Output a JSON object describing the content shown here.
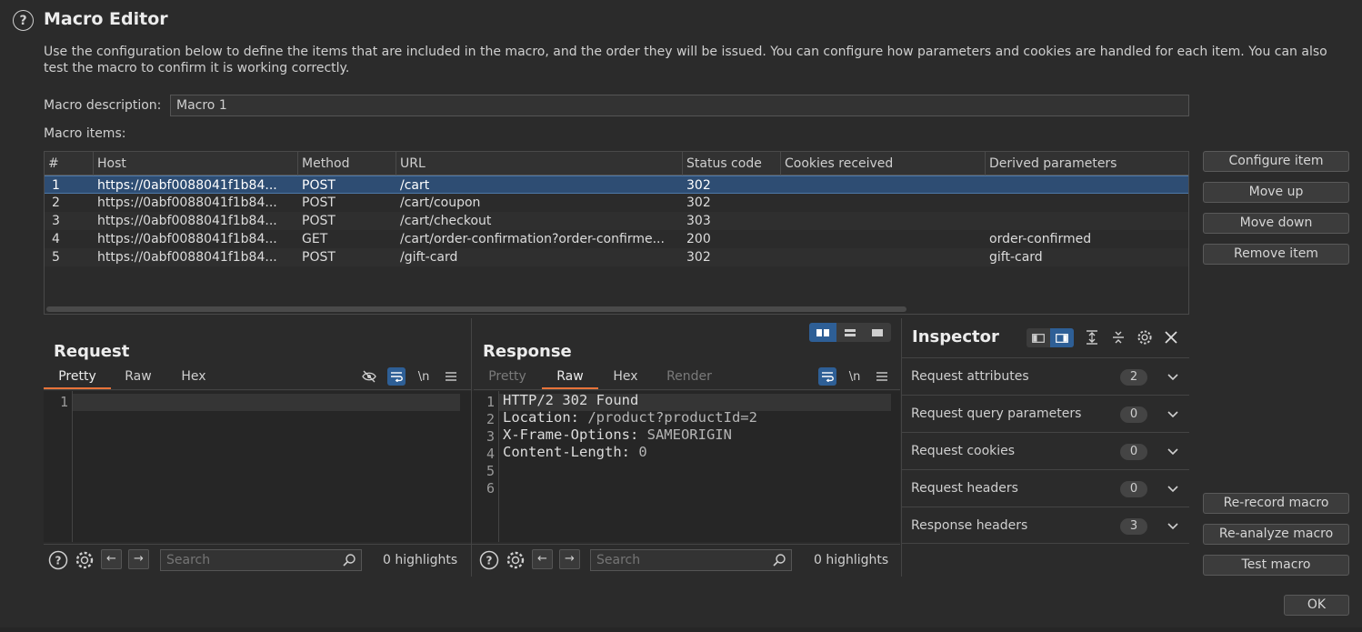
{
  "window": {
    "title": "Macro Editor",
    "description": "Use the configuration below to define the items that are included in the macro, and the order they will be issued. You can configure how parameters and cookies are handled for each item. You can also test the macro to confirm it is working correctly."
  },
  "macro": {
    "description_label": "Macro description:",
    "description_value": "Macro 1",
    "items_label": "Macro items:"
  },
  "table": {
    "columns": [
      "#",
      "Host",
      "Method",
      "URL",
      "Status code",
      "Cookies received",
      "Derived parameters"
    ],
    "rows": [
      {
        "num": "1",
        "host": "https://0abf0088041f1b84...",
        "method": "POST",
        "url": "/cart",
        "status": "302",
        "cookies": "",
        "derived": ""
      },
      {
        "num": "2",
        "host": "https://0abf0088041f1b84...",
        "method": "POST",
        "url": "/cart/coupon",
        "status": "302",
        "cookies": "",
        "derived": ""
      },
      {
        "num": "3",
        "host": "https://0abf0088041f1b84...",
        "method": "POST",
        "url": "/cart/checkout",
        "status": "303",
        "cookies": "",
        "derived": ""
      },
      {
        "num": "4",
        "host": "https://0abf0088041f1b84...",
        "method": "GET",
        "url": "/cart/order-confirmation?order-confirme...",
        "status": "200",
        "cookies": "",
        "derived": "order-confirmed"
      },
      {
        "num": "5",
        "host": "https://0abf0088041f1b84...",
        "method": "POST",
        "url": "/gift-card",
        "status": "302",
        "cookies": "",
        "derived": "gift-card"
      }
    ]
  },
  "item_buttons": {
    "configure": "Configure item",
    "move_up": "Move up",
    "move_down": "Move down",
    "remove": "Remove item"
  },
  "macro_buttons": {
    "rerecord": "Re-record macro",
    "reanalyze": "Re-analyze macro",
    "test": "Test macro",
    "ok": "OK"
  },
  "request": {
    "title": "Request",
    "tabs": [
      "Pretty",
      "Raw",
      "Hex"
    ],
    "active_tab": "Pretty",
    "toggle_newline": "\\n",
    "lines": [
      "1"
    ],
    "search_placeholder": "Search",
    "highlights": "0 highlights"
  },
  "response": {
    "title": "Response",
    "tabs": [
      "Pretty",
      "Raw",
      "Hex",
      "Render"
    ],
    "active_tab": "Raw",
    "toggle_newline": "\\n",
    "line_numbers": [
      "1",
      "2",
      "3",
      "4",
      "5",
      "6"
    ],
    "lines": [
      {
        "key": "HTTP/2 302 Found",
        "value": ""
      },
      {
        "key": "Location:",
        "value": " /product?productId=2"
      },
      {
        "key": "X-Frame-Options:",
        "value": " SAMEORIGIN"
      },
      {
        "key": "Content-Length:",
        "value": " 0"
      }
    ],
    "search_placeholder": "Search",
    "highlights": "0 highlights"
  },
  "inspector": {
    "title": "Inspector",
    "sections": [
      {
        "label": "Request attributes",
        "count": "2"
      },
      {
        "label": "Request query parameters",
        "count": "0"
      },
      {
        "label": "Request cookies",
        "count": "0"
      },
      {
        "label": "Request headers",
        "count": "0"
      },
      {
        "label": "Response headers",
        "count": "3"
      }
    ]
  },
  "colors": {
    "accent_tab": "#e8733a",
    "selection": "#2e4d73",
    "toggle_on": "#2e5f96"
  }
}
